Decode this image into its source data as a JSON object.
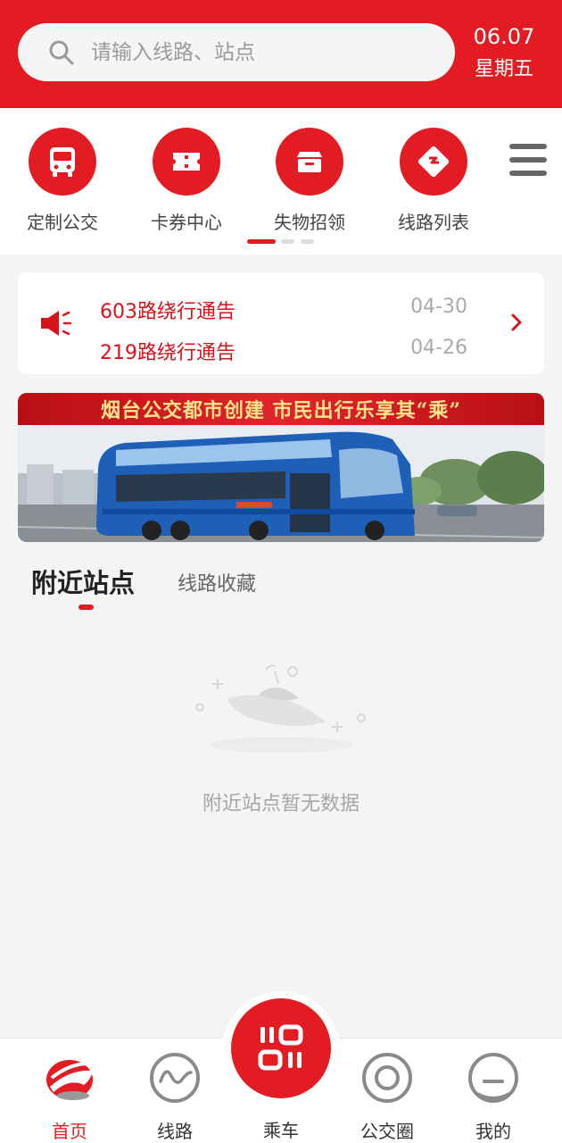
{
  "header": {
    "search_placeholder": "请输入线路、站点",
    "date": "06.07",
    "weekday": "星期五"
  },
  "quick_menu": {
    "items": [
      {
        "label": "定制公交",
        "icon": "bus-icon"
      },
      {
        "label": "卡券中心",
        "icon": "ticket-icon"
      },
      {
        "label": "失物招领",
        "icon": "lost-found-box-icon"
      },
      {
        "label": "线路列表",
        "icon": "route-sign-icon"
      }
    ],
    "more_icon": "hamburger-menu-icon",
    "page_indicator": {
      "pages": 3,
      "current": 1
    }
  },
  "notices": {
    "icon": "speaker-icon",
    "items": [
      {
        "title": "603路绕行通告",
        "date": "04-30"
      },
      {
        "title": "219路绕行通告",
        "date": "04-26"
      }
    ]
  },
  "banner": {
    "text": "烟台公交都市创建  市民出行乐享其“乘”"
  },
  "tabs": {
    "items": [
      "附近站点",
      "线路收藏"
    ],
    "active": 0
  },
  "empty_state": {
    "icon": "ufo-empty-icon",
    "text": "附近站点暂无数据"
  },
  "bottom_nav": {
    "items": [
      {
        "label": "首页",
        "icon": "home-logo-icon",
        "active": true
      },
      {
        "label": "线路",
        "icon": "route-icon",
        "active": false
      },
      {
        "label": "乘车",
        "icon": "ride-code-icon",
        "active": false
      },
      {
        "label": "公交圈",
        "icon": "circle-icon",
        "active": false
      },
      {
        "label": "我的",
        "icon": "profile-icon",
        "active": false
      }
    ]
  },
  "colors": {
    "brand": "#e31b23",
    "background": "#f4f4f4",
    "accent_text": "#d7121b"
  }
}
